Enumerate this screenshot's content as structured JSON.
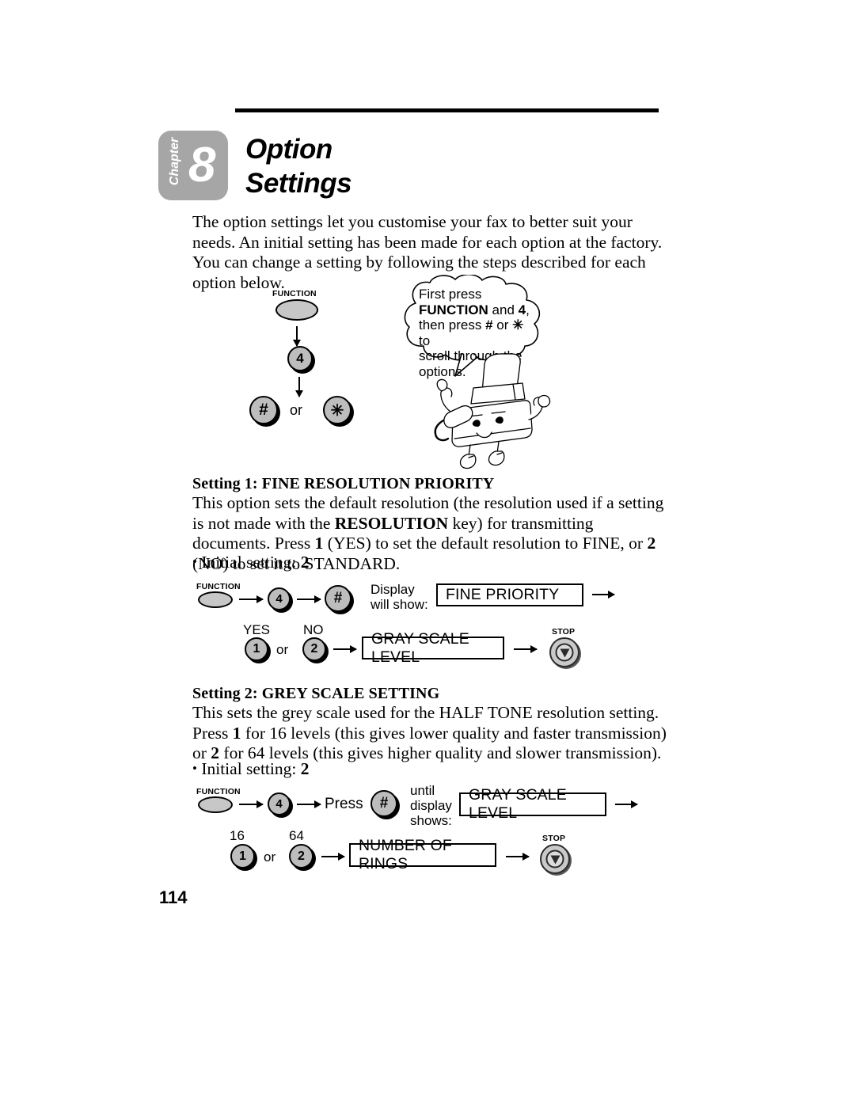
{
  "document": {
    "chapter_word": "Chapter",
    "chapter_number": "8",
    "title_line1": "Option",
    "title_line2": "Settings",
    "page_number": "114"
  },
  "intro": {
    "text": "The option settings let you customise your fax to better suit your needs. An initial setting has been made for each option at the factory. You can change a setting by following the steps described for each option below."
  },
  "top_diagram": {
    "function_label": "FUNCTION",
    "key_4": "4",
    "key_hash": "#",
    "or_text": "or",
    "key_star": "✳",
    "bubble": {
      "line1": "First press",
      "line2_bold_a": "FUNCTION",
      "line2_mid": " and ",
      "line2_bold_b": "4",
      "line2_end": ",",
      "line3_a": "then press ",
      "line3_bold_a": "#",
      "line3_mid": " or ",
      "line3_bold_b": "✳",
      "line3_end": " to",
      "line4": "scroll through the",
      "line5": "options."
    }
  },
  "setting1": {
    "heading_bold": "Setting 1:",
    "heading_rest": " FINE RESOLUTION PRIORITY",
    "body_1": "This option sets the default resolution (the resolution used if a setting is not made with the ",
    "body_bold_1": "RESOLUTION",
    "body_2": " key) for transmitting documents. Press ",
    "body_bold_2": "1",
    "body_3": " (YES) to set the default resolution to FINE, or ",
    "body_bold_3": "2",
    "body_4": " (NO) to set it to STANDARD.",
    "initial_label": "Initial setting: ",
    "initial_value": "2",
    "flow": {
      "function_label": "FUNCTION",
      "key_4": "4",
      "key_hash": "#",
      "display_caption_line1": "Display",
      "display_caption_line2": "will show:",
      "display_value": "FINE PRIORITY",
      "yes_label": "YES",
      "no_label": "NO",
      "key_1": "1",
      "or_text": "or",
      "key_2": "2",
      "result_display": "GRAY SCALE LEVEL",
      "stop_label": "STOP"
    }
  },
  "setting2": {
    "heading_bold": "Setting 2:",
    "heading_rest": " GREY SCALE SETTING",
    "body_1": "This sets the grey scale used for the HALF TONE resolution setting. Press ",
    "body_bold_1": "1",
    "body_2": " for 16 levels (this gives lower quality and faster transmission) or ",
    "body_bold_2": "2",
    "body_3": " for 64 levels (this gives higher quality and slower transmission).",
    "initial_label": "Initial setting: ",
    "initial_value": "2",
    "flow": {
      "function_label": "FUNCTION",
      "key_4": "4",
      "press_text": "Press",
      "key_hash": "#",
      "until_line1": "until",
      "until_line2": "display",
      "until_line3": "shows:",
      "display_value": "GRAY SCALE LEVEL",
      "label_16": "16",
      "label_64": "64",
      "key_1": "1",
      "or_text": "or",
      "key_2": "2",
      "result_display": "NUMBER OF RINGS",
      "stop_label": "STOP"
    }
  },
  "colors": {
    "badge_gray": "#a6a6a6",
    "key_gray": "#bdbdbd",
    "ink": "#000000"
  }
}
